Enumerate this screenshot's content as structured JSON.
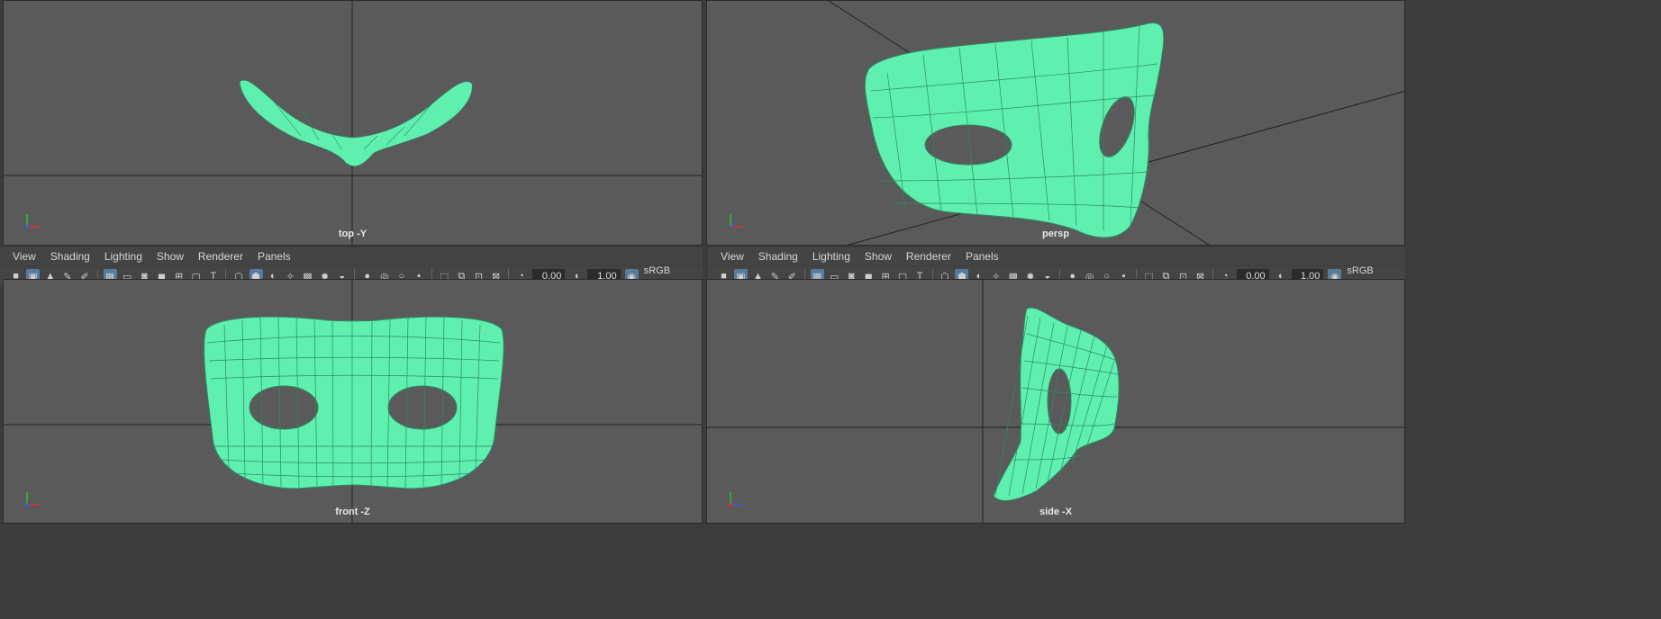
{
  "viewports": {
    "top_label": "top -Y",
    "persp_label": "persp",
    "front_label": "front -Z",
    "side_label": "side -X"
  },
  "panel_menu": [
    "View",
    "Shading",
    "Lighting",
    "Show",
    "Renderer",
    "Panels"
  ],
  "toolbar": {
    "exposure": "0.00",
    "gamma": "1.00",
    "colorspace": "sRGB gamma"
  },
  "colors": {
    "viewport_bg": "#5a5a5a",
    "wireframe": "#5ff0b0",
    "ui_bg": "#444444"
  },
  "icons": [
    "camera-icon",
    "grid-icon",
    "wireframe-icon",
    "smooth-shade-icon",
    "texture-icon",
    "light-icon",
    "shadow-icon",
    "isolate-icon",
    "exposure-icon",
    "gamma-icon",
    "colorspace-icon"
  ]
}
